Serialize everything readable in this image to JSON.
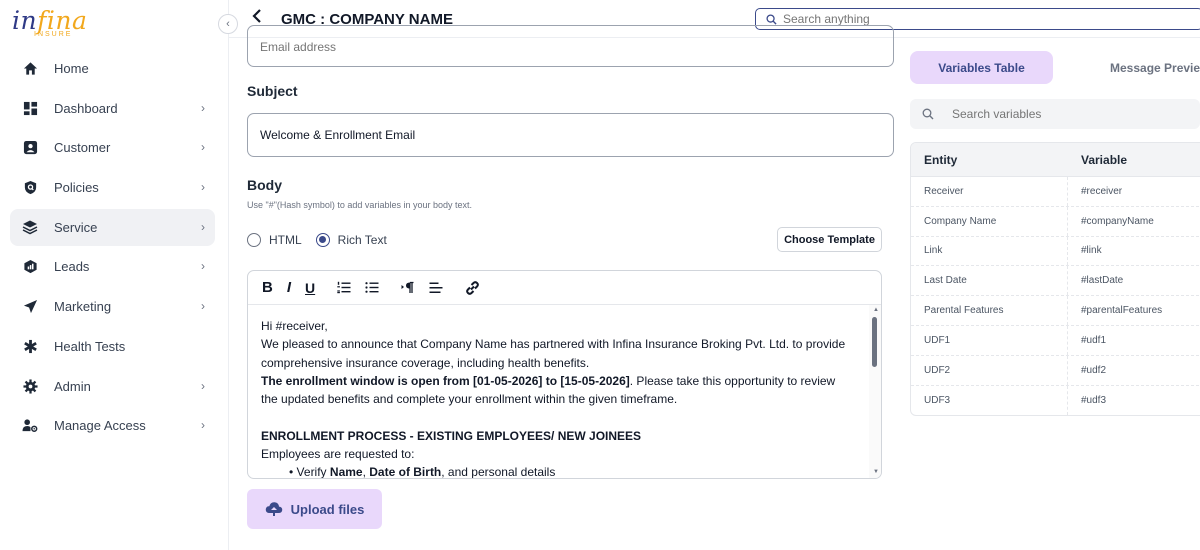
{
  "brand": {
    "logo_text_1": "in",
    "logo_text_2": "fina",
    "logo_sub": "INSURE"
  },
  "sidebar": {
    "collapse_icon": "chevron-left-icon",
    "items": [
      {
        "label": "Home",
        "icon": "home-icon",
        "has_chevron": false,
        "active": false
      },
      {
        "label": "Dashboard",
        "icon": "dashboard-icon",
        "has_chevron": true,
        "active": false
      },
      {
        "label": "Customer",
        "icon": "customer-icon",
        "has_chevron": true,
        "active": false
      },
      {
        "label": "Policies",
        "icon": "policies-icon",
        "has_chevron": true,
        "active": false
      },
      {
        "label": "Service",
        "icon": "layers-icon",
        "has_chevron": true,
        "active": true
      },
      {
        "label": "Leads",
        "icon": "leads-icon",
        "has_chevron": true,
        "active": false
      },
      {
        "label": "Marketing",
        "icon": "send-icon",
        "has_chevron": true,
        "active": false
      },
      {
        "label": "Health Tests",
        "icon": "asterisk-icon",
        "has_chevron": false,
        "active": false
      },
      {
        "label": "Admin",
        "icon": "gear-icon",
        "has_chevron": true,
        "active": false
      },
      {
        "label": "Manage Access",
        "icon": "user-gear-icon",
        "has_chevron": true,
        "active": false
      }
    ]
  },
  "header": {
    "title": "GMC : COMPANY NAME",
    "search_placeholder": "Search anything"
  },
  "form": {
    "email_placeholder": "Email address",
    "subject_label": "Subject",
    "subject_value": "Welcome & Enrollment Email",
    "body_label": "Body",
    "body_hint": "Use \"#\"(Hash symbol) to add variables in your body text.",
    "format_options": [
      {
        "label": "HTML",
        "selected": false
      },
      {
        "label": "Rich Text",
        "selected": true
      }
    ],
    "choose_template_label": "Choose Template",
    "toolbar": [
      "bold",
      "italic",
      "underline",
      "ordered-list",
      "bullet-list",
      "paragraph-direction",
      "align-left",
      "link"
    ],
    "body": {
      "greeting": "Hi #receiver,",
      "para1": "We pleased to announce that Company Name has partnered with Infina Insurance Broking Pvt. Ltd. to provide comprehensive insurance coverage, including health benefits.",
      "para2_bold": "The enrollment window is open from [01-05-2026] to [15-05-2026]",
      "para2_rest": ". Please take this opportunity to review the updated benefits and complete your enrollment within the given timeframe.",
      "section_heading": "ENROLLMENT PROCESS - EXISTING EMPLOYEES/ NEW JOINEES",
      "section_intro": "Employees are requested to:",
      "bullet1_pre": "Verify ",
      "bullet1_b1": "Name",
      "bullet1_mid": ", ",
      "bullet1_b2": "Date of Birth",
      "bullet1_post": ", and personal details"
    },
    "upload_label": "Upload files"
  },
  "right_panel": {
    "tabs": {
      "variables": "Variables Table",
      "preview": "Message Preview"
    },
    "search_placeholder": "Search variables",
    "table": {
      "headers": {
        "entity": "Entity",
        "variable": "Variable"
      },
      "rows": [
        {
          "entity": "Receiver",
          "variable": "#receiver"
        },
        {
          "entity": "Company Name",
          "variable": "#companyName"
        },
        {
          "entity": "Link",
          "variable": "#link"
        },
        {
          "entity": "Last Date",
          "variable": "#lastDate"
        },
        {
          "entity": "Parental Features",
          "variable": "#parentalFeatures"
        },
        {
          "entity": "UDF1",
          "variable": "#udf1"
        },
        {
          "entity": "UDF2",
          "variable": "#udf2"
        },
        {
          "entity": "UDF3",
          "variable": "#udf3"
        }
      ]
    }
  },
  "colors": {
    "accent": "#3b4a8a",
    "accent_light": "#e9d8fb",
    "brand_gold": "#f2a81d"
  }
}
